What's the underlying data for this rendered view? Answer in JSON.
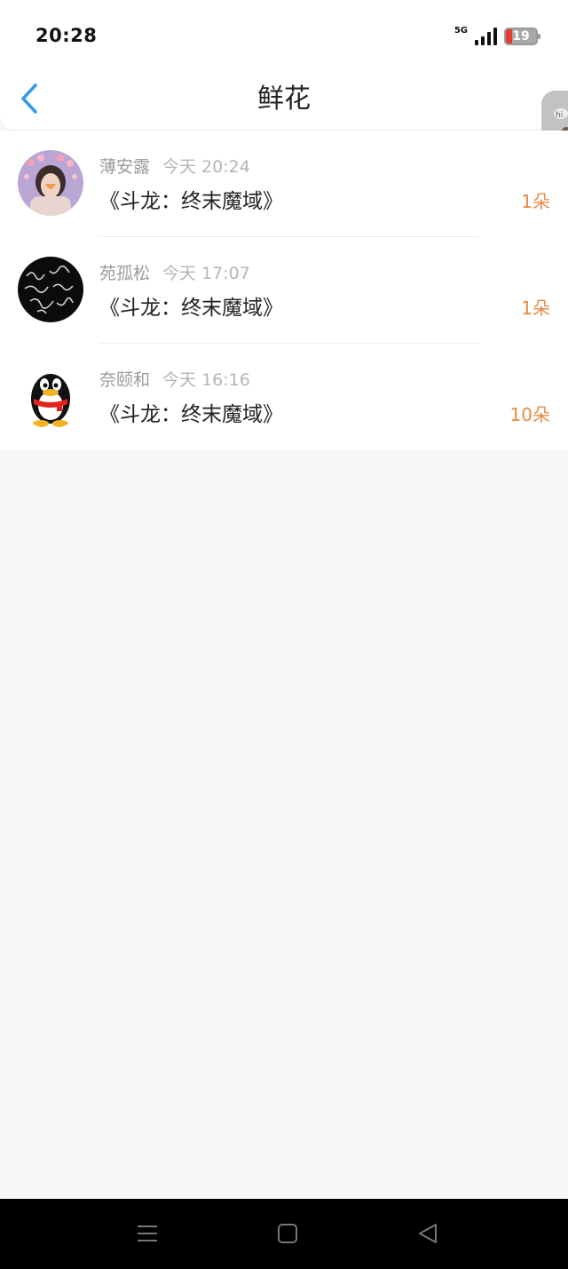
{
  "status_bar": {
    "time": "20:28",
    "network": "5G",
    "battery_level": "19",
    "battery_color": "#e33b32"
  },
  "header": {
    "title": "鲜花",
    "back_icon": "chevron-left-icon",
    "accent_color": "#2f9bf0"
  },
  "gifts": [
    {
      "name": "薄安露",
      "time": "今天 20:24",
      "book": "《斗龙：终末魔域》",
      "count": "1朵",
      "avatar": "photo-avatar"
    },
    {
      "name": "苑孤松",
      "time": "今天 17:07",
      "book": "《斗龙：终末魔域》",
      "count": "1朵",
      "avatar": "signature-avatar"
    },
    {
      "name": "奈颐和",
      "time": "今天 16:16",
      "book": "《斗龙：终末魔域》",
      "count": "10朵",
      "avatar": "penguin-avatar"
    }
  ],
  "nav_bar": {
    "menu_icon": "menu-icon",
    "home_icon": "home-icon",
    "back_icon": "back-triangle-icon"
  }
}
